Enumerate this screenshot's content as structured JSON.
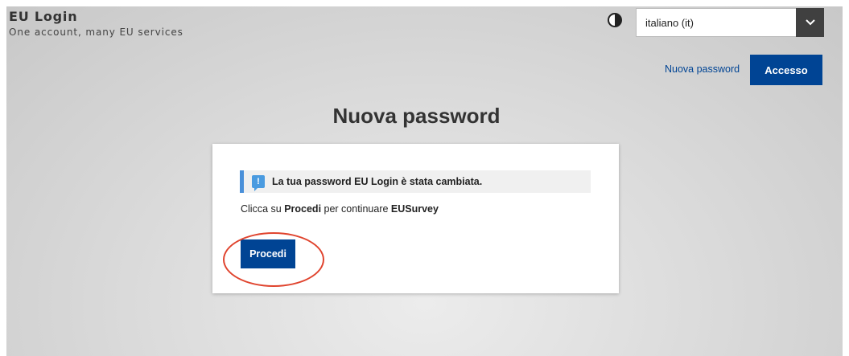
{
  "header": {
    "brand_title": "EU Login",
    "brand_subtitle": "One account, many EU services",
    "contrast_icon": "contrast-icon",
    "language": {
      "selected": "italiano (it)",
      "icon": "chevron-down-icon"
    }
  },
  "nav": {
    "new_password_link": "Nuova password",
    "login_button": "Accesso"
  },
  "main": {
    "title": "Nuova password",
    "alert": {
      "icon": "info-message-icon",
      "text": "La tua password EU Login è stata cambiata."
    },
    "instruction": {
      "prefix": "Clicca su ",
      "action": "Procedi",
      "middle": " per continuare ",
      "service": "EUSurvey"
    },
    "proceed_button": "Procedi"
  },
  "colors": {
    "brand_blue": "#004494",
    "alert_accent": "#4a90d9",
    "annotation_red": "#e0442e"
  }
}
